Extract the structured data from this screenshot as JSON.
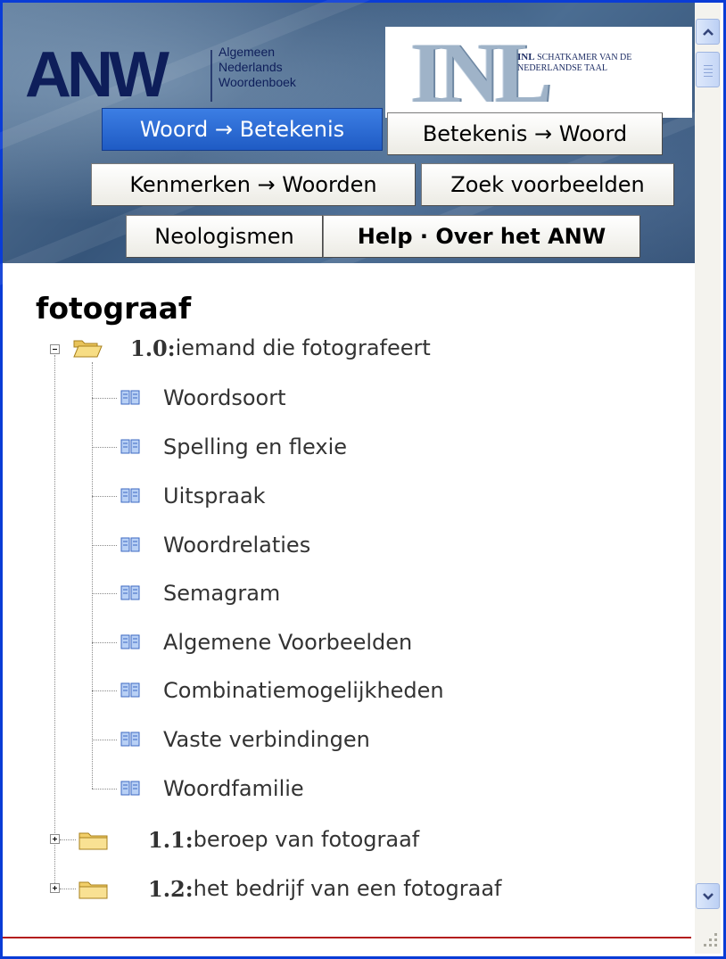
{
  "header": {
    "anw_logo": "ANW",
    "anw_subtitle": [
      "Algemeen",
      "Nederlands",
      "Woordenboek"
    ],
    "inl_logo": "INL",
    "inl_text_bold": "INL",
    "inl_text_rest": " SCHATKAMER VAN DE NEDERLANDSE TAAL"
  },
  "tabs": {
    "woord_betekenis": "Woord → Betekenis",
    "betekenis_woord": "Betekenis → Woord",
    "kenmerken_woorden": "Kenmerken → Woorden",
    "zoek_voorbeelden": "Zoek voorbeelden",
    "neologismen": "Neologismen",
    "help": "Help · Over het ANW"
  },
  "entry": {
    "word": "fotograaf",
    "senses": [
      {
        "num": "1.0:",
        "text": " iemand die fotografeert",
        "expanded": true,
        "children": [
          "Woordsoort",
          "Spelling en flexie",
          "Uitspraak",
          "Woordrelaties",
          "Semagram",
          "Algemene Voorbeelden",
          "Combinatiemogelijkheden",
          "Vaste verbindingen",
          "Woordfamilie"
        ]
      },
      {
        "num": "1.1:",
        "text": " beroep van fotograaf",
        "expanded": false
      },
      {
        "num": "1.2:",
        "text": " het bedrijf van een fotograaf",
        "expanded": false
      }
    ]
  },
  "colors": {
    "frame": "#0a3cd6",
    "active_tab": "#2563cf",
    "rule": "#b31d1d"
  },
  "icons": [
    "minus-box-icon",
    "open-folder-icon",
    "book-icon",
    "plus-box-icon",
    "closed-folder-icon",
    "scroll-up-icon",
    "scroll-down-icon",
    "resize-grip-icon"
  ]
}
